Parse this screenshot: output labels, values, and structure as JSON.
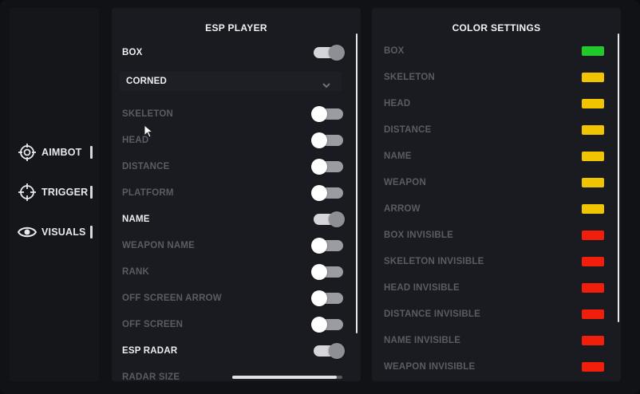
{
  "sidebar": {
    "items": [
      {
        "label": "AIMBOT",
        "icon": "crosshair-icon"
      },
      {
        "label": "TRIGGER",
        "icon": "target-icon"
      },
      {
        "label": "VISUALS",
        "icon": "eye-icon"
      }
    ]
  },
  "esp": {
    "title": "ESP PLAYER",
    "box_label": "BOX",
    "box_style": "CORNED",
    "toggles": [
      {
        "label": "SKELETON",
        "on": false
      },
      {
        "label": "HEAD",
        "on": false
      },
      {
        "label": "DISTANCE",
        "on": false
      },
      {
        "label": "PLATFORM",
        "on": false
      },
      {
        "label": "NAME",
        "on": true
      },
      {
        "label": "WEAPON NAME",
        "on": false
      },
      {
        "label": "RANK",
        "on": false
      },
      {
        "label": "OFF SCREEN ARROW",
        "on": false
      },
      {
        "label": "OFF SCREEN",
        "on": false
      },
      {
        "label": "ESP RADAR",
        "on": true
      }
    ],
    "box_on": true,
    "radar_size_label": "RADAR SIZE",
    "radar_size_value": 0.95
  },
  "colors": {
    "title": "COLOR SETTINGS",
    "items": [
      {
        "label": "BOX",
        "color": "#22c92c"
      },
      {
        "label": "SKELETON",
        "color": "#f0c400"
      },
      {
        "label": "HEAD",
        "color": "#f0c400"
      },
      {
        "label": "DISTANCE",
        "color": "#f0c400"
      },
      {
        "label": "NAME",
        "color": "#f0c400"
      },
      {
        "label": "WEAPON",
        "color": "#f0c400"
      },
      {
        "label": "ARROW",
        "color": "#f0c400"
      },
      {
        "label": "BOX INVISIBLE",
        "color": "#f01e0a"
      },
      {
        "label": "SKELETON INVISIBLE",
        "color": "#f01e0a"
      },
      {
        "label": "HEAD INVISIBLE",
        "color": "#f01e0a"
      },
      {
        "label": "DISTANCE INVISIBLE",
        "color": "#f01e0a"
      },
      {
        "label": "NAME INVISIBLE",
        "color": "#f01e0a"
      },
      {
        "label": "WEAPON INVISIBLE",
        "color": "#f01e0a"
      }
    ]
  }
}
